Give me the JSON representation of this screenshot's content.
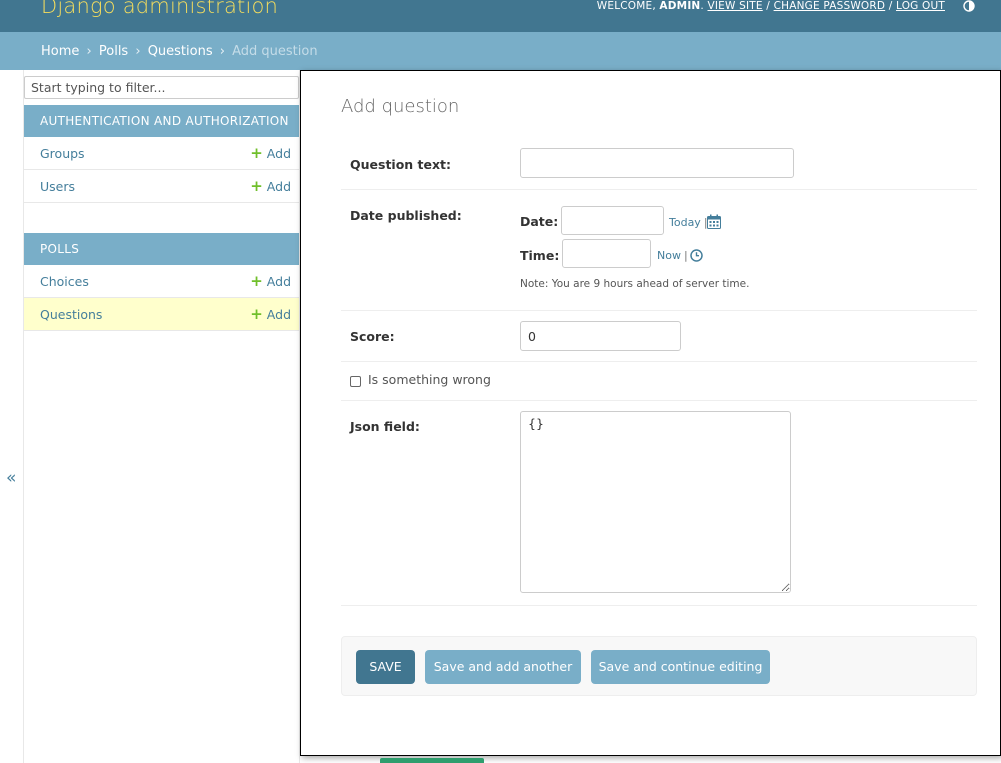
{
  "header": {
    "brand": "Django administration",
    "welcome": "Welcome,",
    "user": "admin",
    "view_site": "View site",
    "change_password": "Change password",
    "log_out": "Log out",
    "separator": "/"
  },
  "breadcrumbs": {
    "home": "Home",
    "app": "Polls",
    "model": "Questions",
    "current": "Add question",
    "sep": "›"
  },
  "sidebar": {
    "filter_placeholder": "Start typing to filter...",
    "toggle": "«",
    "modules": [
      {
        "caption": "Authentication and Authorization",
        "rows": [
          {
            "name": "Groups",
            "add": "Add"
          },
          {
            "name": "Users",
            "add": "Add"
          }
        ]
      },
      {
        "caption": "Polls",
        "rows": [
          {
            "name": "Choices",
            "add": "Add"
          },
          {
            "name": "Questions",
            "add": "Add"
          }
        ]
      }
    ]
  },
  "form": {
    "title": "Add question",
    "question_text_label": "Question text:",
    "question_text_value": "",
    "date_published_label": "Date published:",
    "date_label": "Date:",
    "date_value": "",
    "today": "Today",
    "time_label": "Time:",
    "time_value": "",
    "now": "Now",
    "timezone_note": "Note: You are 9 hours ahead of server time.",
    "score_label": "Score:",
    "score_value": "0",
    "checkbox_label": "Is something wrong",
    "json_label": "Json field:",
    "json_value": "{}"
  },
  "buttons": {
    "save": "SAVE",
    "save_add_another": "Save and add another",
    "save_continue": "Save and continue editing"
  },
  "colors": {
    "header": "#417690",
    "breadcrumbs": "#79aec8",
    "brand_yellow": "#f5dd5d",
    "link": "#447e9b",
    "add_plus": "#70bf2b",
    "current_row": "#ffffcc"
  }
}
